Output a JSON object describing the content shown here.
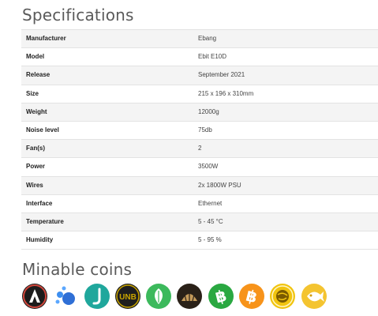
{
  "specifications": {
    "title": "Specifications",
    "rows": [
      {
        "key": "Manufacturer",
        "value": "Ebang"
      },
      {
        "key": "Model",
        "value": "Ebit E10D"
      },
      {
        "key": "Release",
        "value": "September 2021"
      },
      {
        "key": "Size",
        "value": "215 x 196 x 310mm"
      },
      {
        "key": "Weight",
        "value": "12000g"
      },
      {
        "key": "Noise level",
        "value": "75db"
      },
      {
        "key": "Fan(s)",
        "value": "2"
      },
      {
        "key": "Power",
        "value": "3500W"
      },
      {
        "key": "Wires",
        "value": "2x 1800W PSU"
      },
      {
        "key": "Interface",
        "value": "Ethernet"
      },
      {
        "key": "Temperature",
        "value": "5 - 45 °C"
      },
      {
        "key": "Humidity",
        "value": "5 - 95 %"
      }
    ]
  },
  "minable_coins": {
    "title": "Minable coins",
    "coins": [
      {
        "icon": "arweave-style-coin-icon",
        "bg": "#1c1c1c",
        "accent": "#ffffff"
      },
      {
        "icon": "dots-coin-icon",
        "bg": "#ffffff",
        "accent": "#2f80ed"
      },
      {
        "icon": "teal-s-coin-icon",
        "bg": "#1fa79c",
        "accent": "#ffffff"
      },
      {
        "icon": "unb-coin-icon",
        "bg": "#1e1e1e",
        "accent": "#c8a400",
        "text": "UNB"
      },
      {
        "icon": "green-leaf-coin-icon",
        "bg": "#3cb95c",
        "accent": "#ffffff"
      },
      {
        "icon": "shell-coin-icon",
        "bg": "#2a2118",
        "accent": "#c49a5a"
      },
      {
        "icon": "bitcoin-cash-icon",
        "bg": "#2aa841",
        "accent": "#ffffff"
      },
      {
        "icon": "bitcoin-icon",
        "bg": "#f7931a",
        "accent": "#ffffff"
      },
      {
        "icon": "gold-globe-coin-icon",
        "bg": "#f1c40f",
        "accent": "#7a5a00"
      },
      {
        "icon": "gold-fish-coin-icon",
        "bg": "#f4c430",
        "accent": "#ffffff"
      }
    ]
  }
}
